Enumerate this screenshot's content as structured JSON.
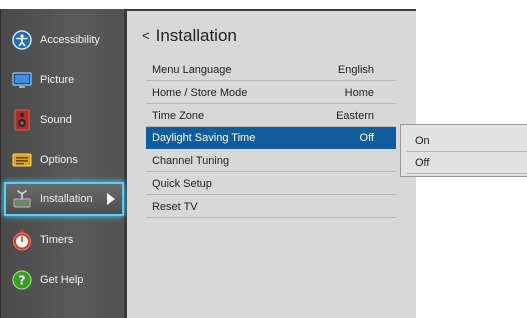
{
  "sidebar": {
    "items": [
      {
        "label": "Accessibility",
        "icon": "accessibility-icon"
      },
      {
        "label": "Picture",
        "icon": "picture-icon"
      },
      {
        "label": "Sound",
        "icon": "sound-icon"
      },
      {
        "label": "Options",
        "icon": "options-icon"
      },
      {
        "label": "Installation",
        "icon": "installation-icon"
      },
      {
        "label": "Timers",
        "icon": "timers-icon"
      },
      {
        "label": "Get Help",
        "icon": "get-help-icon"
      }
    ],
    "selected": "Installation"
  },
  "main": {
    "back_glyph": "<",
    "title": "Installation",
    "rows": [
      {
        "label": "Menu Language",
        "value": "English"
      },
      {
        "label": "Home / Store Mode",
        "value": "Home"
      },
      {
        "label": "Time Zone",
        "value": "Eastern"
      },
      {
        "label": "Daylight Saving Time",
        "value": "Off"
      },
      {
        "label": "Channel Tuning",
        "value": ""
      },
      {
        "label": "Quick Setup",
        "value": ""
      },
      {
        "label": "Reset TV",
        "value": ""
      }
    ],
    "highlighted_row": "Daylight Saving Time"
  },
  "submenu": {
    "options": [
      "On",
      "Off"
    ]
  },
  "colors": {
    "highlight": "#0f5d9c",
    "selection_glow": "#4fd2ff",
    "sidebar_bg": "#555555",
    "panel_bg": "#d8d8d8"
  }
}
